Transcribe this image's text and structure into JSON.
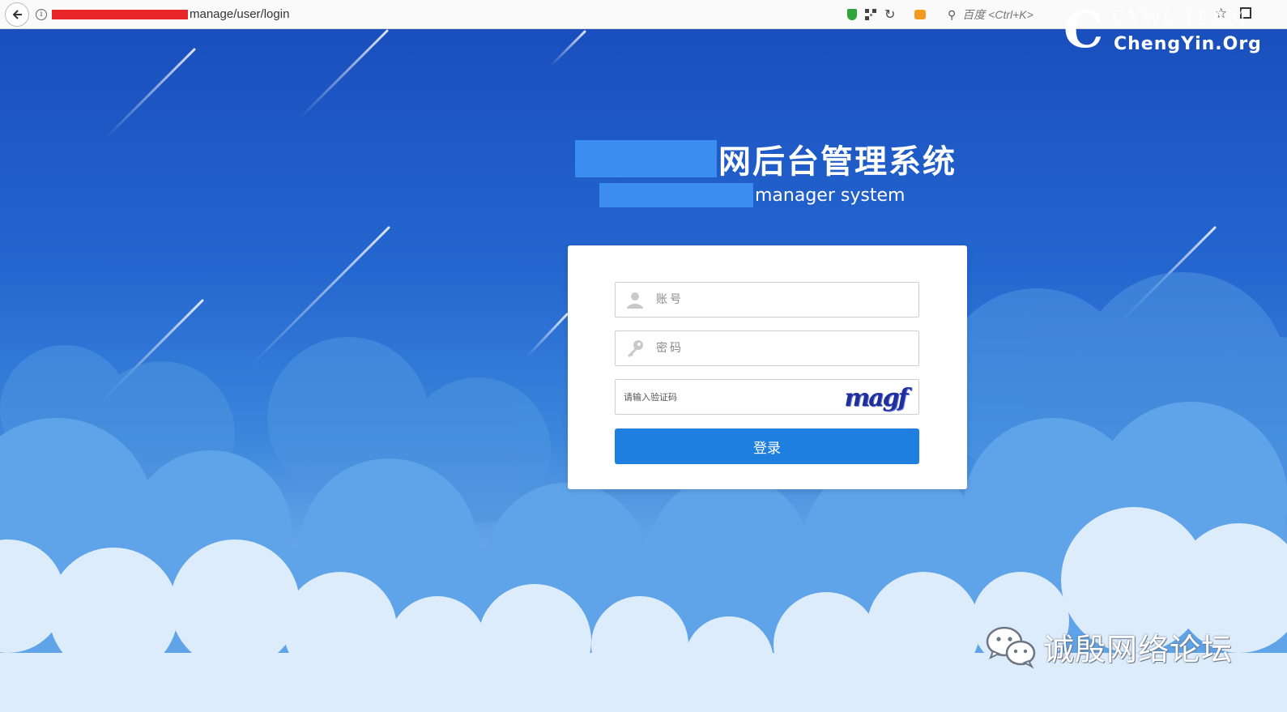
{
  "browser": {
    "url_suffix": "manage/user/login",
    "search_placeholder": "百度 <Ctrl+K>"
  },
  "watermark": {
    "team": "CYWL TEAM",
    "site": "ChengYin.Org"
  },
  "header": {
    "title_cn": "网后台管理系统",
    "title_en": "manager system"
  },
  "login": {
    "username_placeholder": "账号",
    "password_placeholder": "密码",
    "captcha_placeholder": "请输入验证码",
    "captcha_text": "magf",
    "submit_label": "登录"
  },
  "footer": {
    "brand": "诚殷网络论坛"
  },
  "colors": {
    "sky_top": "#1a4fbd",
    "button": "#1e7fe0",
    "redaction_red": "#e8262a",
    "redaction_blue": "#3b8ef0"
  }
}
